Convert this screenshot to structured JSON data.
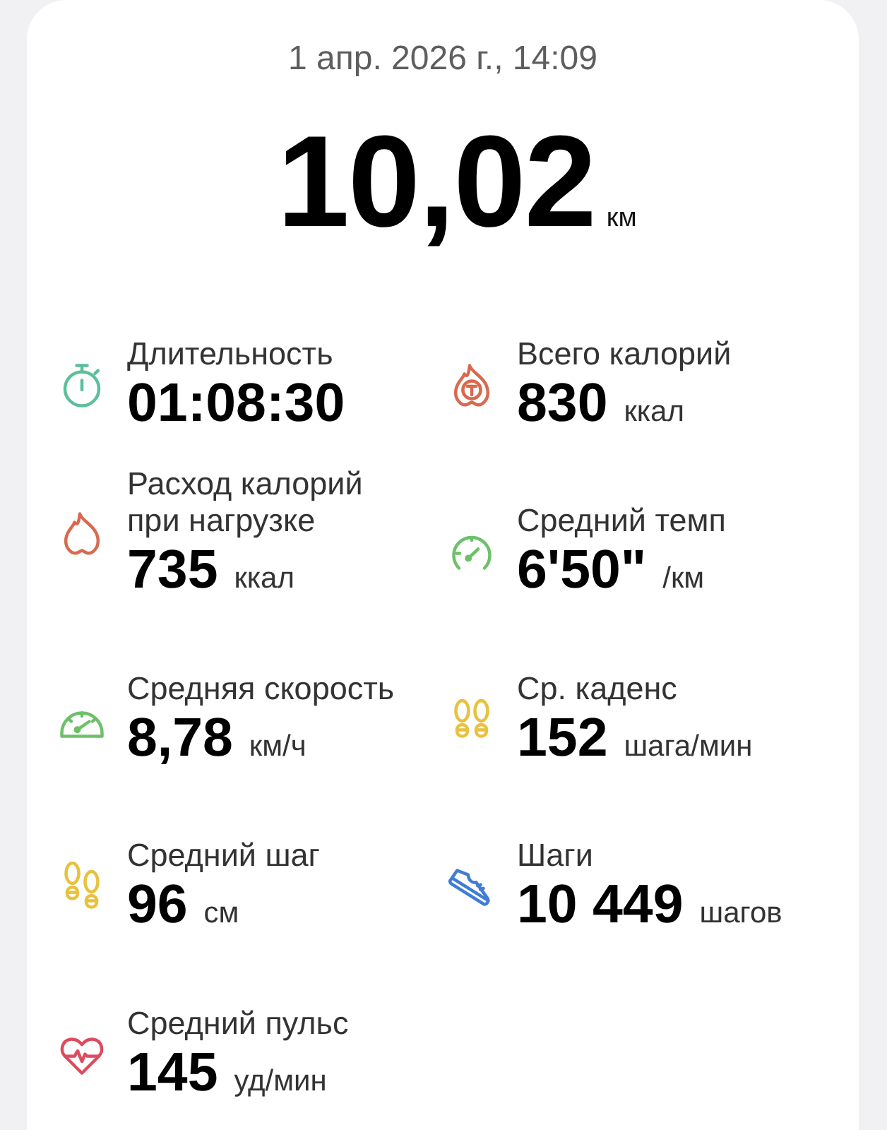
{
  "summary": {
    "date": "1 апр. 2026 г., 14:09",
    "distance": "10,02",
    "distance_unit": "км"
  },
  "stats": [
    {
      "kind": "stopwatch",
      "color": "#5cbf9a",
      "label": "Длительность",
      "value": "01:08:30"
    },
    {
      "kind": "totalflame",
      "color": "#d86a4f",
      "label": "Всего калорий",
      "value": "830",
      "unit": "ккал"
    },
    {
      "kind": "flame",
      "color": "#d86a4f",
      "label": "Расход калорий при нагрузке",
      "value": "735",
      "unit": "ккал"
    },
    {
      "kind": "dial",
      "color": "#6cc168",
      "label": "Средний темп",
      "value": "6'50\"",
      "unit": "/км"
    },
    {
      "kind": "speedometer",
      "color": "#6cc168",
      "label": "Средняя скорость",
      "value": "8,78",
      "unit": "км/ч"
    },
    {
      "kind": "footprints",
      "color": "#e8c13f",
      "label": "Ср. каденс",
      "value": "152",
      "unit": "шага/мин"
    },
    {
      "kind": "stride",
      "color": "#e8c13f",
      "label": "Средний шаг",
      "value": "96",
      "unit": "см"
    },
    {
      "kind": "shoe",
      "color": "#3f7dd6",
      "label": "Шаги",
      "value": "10 449",
      "unit": "шагов"
    },
    {
      "kind": "heart",
      "color": "#dc4b5e",
      "label": "Средний пульс",
      "value": "145",
      "unit": "уд/мин"
    }
  ]
}
